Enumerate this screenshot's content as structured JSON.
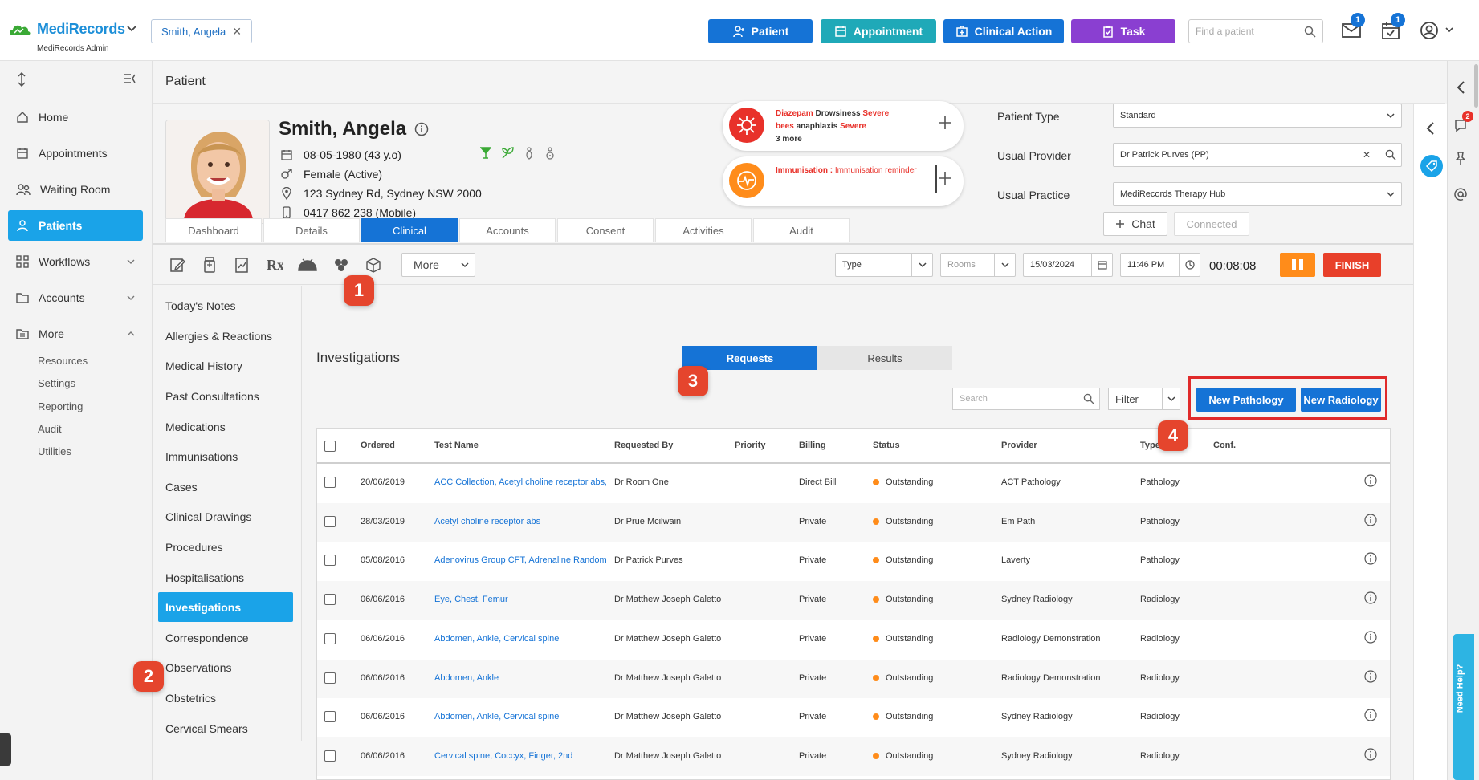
{
  "app": {
    "logo_text": "MediRecords",
    "admin_label": "MediRecords Admin",
    "patient_chip": "Smith, Angela",
    "actions": [
      {
        "label": "Patient",
        "icon": "user-plus-icon",
        "color": "#1573d6"
      },
      {
        "label": "Appointment",
        "icon": "calendar-icon",
        "color": "#1fa9b8"
      },
      {
        "label": "Clinical Action",
        "icon": "medical-kit-icon",
        "color": "#1573d6"
      },
      {
        "label": "Task",
        "icon": "clipboard-icon",
        "color": "#8a3fd1"
      }
    ],
    "find_placeholder": "Find a patient",
    "mail_count": "1",
    "task_count": "1"
  },
  "sidebar": {
    "items": [
      {
        "label": "Home",
        "icon": "home-icon"
      },
      {
        "label": "Appointments",
        "icon": "calendar-icon"
      },
      {
        "label": "Waiting Room",
        "icon": "people-icon"
      },
      {
        "label": "Patients",
        "icon": "person-icon"
      },
      {
        "label": "Workflows",
        "icon": "workflow-icon"
      },
      {
        "label": "Accounts",
        "icon": "folder-icon"
      },
      {
        "label": "More",
        "icon": "folder-tree-icon"
      }
    ],
    "sub_items": [
      "Resources",
      "Settings",
      "Reporting",
      "Audit",
      "Utilities"
    ]
  },
  "page_title": "Patient",
  "patient": {
    "name": "Smith, Angela",
    "dob": "08-05-1980 (43 y.o)",
    "gender": "Female (Active)",
    "address": "123 Sydney Rd, Sydney NSW 2000",
    "phone": "0417 862 238 (Mobile)"
  },
  "alerts": {
    "allergy_1_drug": "Diazepam",
    "allergy_1_reaction": "Drowsiness",
    "allergy_1_severity": "Severe",
    "allergy_2_drug": "bees",
    "allergy_2_reaction": "anaphlaxis",
    "allergy_2_severity": "Severe",
    "allergy_more": "3 more",
    "immunisation_label": "Immunisation :",
    "immunisation_text": "Immunisation reminder"
  },
  "fields": {
    "patient_type_label": "Patient Type",
    "patient_type_value": "Standard",
    "usual_provider_label": "Usual Provider",
    "usual_provider_value": "Dr Patrick Purves (PP)",
    "usual_practice_label": "Usual Practice",
    "usual_practice_value": "MediRecords Therapy Hub",
    "chat_label": "Chat",
    "connected_label": "Connected"
  },
  "tabs": [
    "Dashboard",
    "Details",
    "Clinical",
    "Accounts",
    "Consent",
    "Activities",
    "Audit"
  ],
  "toolbar": {
    "more_label": "More",
    "type_placeholder": "Type",
    "rooms_placeholder": "Rooms",
    "date": "15/03/2024",
    "time": "11:46 PM",
    "timer": "00:08:08",
    "finish_label": "FINISH"
  },
  "clinical_menu": [
    "Today's Notes",
    "Allergies & Reactions",
    "Medical History",
    "Past Consultations",
    "Medications",
    "Immunisations",
    "Cases",
    "Clinical Drawings",
    "Procedures",
    "Hospitalisations",
    "Investigations",
    "Correspondence",
    "Observations",
    "Obstetrics",
    "Cervical Smears"
  ],
  "investigations": {
    "title": "Investigations",
    "tab_requests": "Requests",
    "tab_results": "Results",
    "search_placeholder": "Search",
    "filter_label": "Filter",
    "new_pathology": "New Pathology",
    "new_radiology": "New Radiology",
    "columns": [
      "Ordered",
      "Test Name",
      "Requested By",
      "Priority",
      "Billing",
      "Status",
      "Provider",
      "Type",
      "Conf."
    ],
    "rows": [
      {
        "ordered": "20/06/2019",
        "test": "ACC Collection, Acetyl choline receptor abs,...",
        "requested_by": "Dr Room One",
        "priority": "",
        "billing": "Direct Bill",
        "status": "Outstanding",
        "provider": "ACT Pathology",
        "type": "Pathology"
      },
      {
        "ordered": "28/03/2019",
        "test": "Acetyl choline receptor abs",
        "requested_by": "Dr Prue Mcilwain",
        "priority": "",
        "billing": "Private",
        "status": "Outstanding",
        "provider": "Em Path",
        "type": "Pathology"
      },
      {
        "ordered": "05/08/2016",
        "test": "Adenovirus Group CFT, Adrenaline Random...",
        "requested_by": "Dr Patrick Purves",
        "priority": "",
        "billing": "Private",
        "status": "Outstanding",
        "provider": "Laverty",
        "type": "Pathology"
      },
      {
        "ordered": "06/06/2016",
        "test": "Eye, Chest, Femur",
        "requested_by": "Dr Matthew Joseph Galetto",
        "priority": "",
        "billing": "Private",
        "status": "Outstanding",
        "provider": "Sydney Radiology",
        "type": "Radiology"
      },
      {
        "ordered": "06/06/2016",
        "test": "Abdomen, Ankle, Cervical spine",
        "requested_by": "Dr Matthew Joseph Galetto",
        "priority": "",
        "billing": "Private",
        "status": "Outstanding",
        "provider": "Radiology Demonstration",
        "type": "Radiology"
      },
      {
        "ordered": "06/06/2016",
        "test": "Abdomen, Ankle",
        "requested_by": "Dr Matthew Joseph Galetto",
        "priority": "",
        "billing": "Private",
        "status": "Outstanding",
        "provider": "Radiology Demonstration",
        "type": "Radiology"
      },
      {
        "ordered": "06/06/2016",
        "test": "Abdomen, Ankle, Cervical spine",
        "requested_by": "Dr Matthew Joseph Galetto",
        "priority": "",
        "billing": "Private",
        "status": "Outstanding",
        "provider": "Sydney Radiology",
        "type": "Radiology"
      },
      {
        "ordered": "06/06/2016",
        "test": "Cervical spine, Coccyx, Finger, 2nd",
        "requested_by": "Dr Matthew Joseph Galetto",
        "priority": "",
        "billing": "Private",
        "status": "Outstanding",
        "provider": "Sydney Radiology",
        "type": "Radiology"
      }
    ]
  },
  "callouts": [
    "1",
    "2",
    "3",
    "4"
  ],
  "rail": {
    "notification_count": "2",
    "need_help": "Need Help?"
  }
}
